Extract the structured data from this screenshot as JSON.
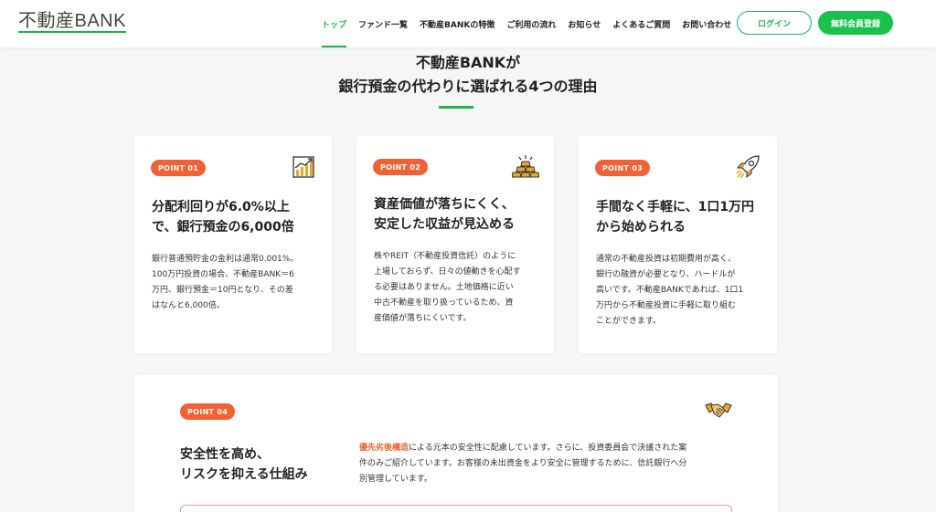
{
  "header": {
    "logo": "不動産BANK",
    "nav": [
      {
        "label": "トップ",
        "active": true
      },
      {
        "label": "ファンド一覧",
        "active": false
      },
      {
        "label": "不動産BANKの特徴",
        "active": false
      },
      {
        "label": "ご利用の流れ",
        "active": false
      },
      {
        "label": "お知らせ",
        "active": false
      },
      {
        "label": "よくあるご質問",
        "active": false
      },
      {
        "label": "お問い合わせ",
        "active": false
      }
    ],
    "login_label": "ログイン",
    "register_label": "無料会員登録"
  },
  "section": {
    "title_line1": "不動産BANKが",
    "title_line2": "銀行預金の代わりに選ばれる4つの理由"
  },
  "points": [
    {
      "badge": "POINT 01",
      "icon": "chart-growth-icon",
      "heading_line1": "分配利回りが6.0%以上",
      "heading_line2": "で、銀行預金の6,000倍",
      "body": [
        "銀行普通預貯金の金利は通常0.001%。",
        "100万円投資の場合、不動産BANK＝6",
        "万円、銀行預金＝10円となり、その差",
        "はなんと6,000倍。"
      ]
    },
    {
      "badge": "POINT 02",
      "icon": "gold-bars-icon",
      "heading_line1": "資産価値が落ちにくく、",
      "heading_line2": "安定した収益が見込める",
      "body": [
        "株やREIT（不動産投資信託）のように",
        "上場しておらず、日々の値動きを心配す",
        "る必要はありません。土地価格に近い",
        "中古不動産を取り扱っているため、資",
        "産価値が落ちにくいです。"
      ]
    },
    {
      "badge": "POINT 03",
      "icon": "rocket-icon",
      "heading_line1": "手間なく手軽に、1口1万円",
      "heading_line2": "から始められる",
      "body": [
        "通常の不動産投資は初期費用が高く、",
        "銀行の融資が必要となり、ハードルが",
        "高いです。不動産BANKであれば、1口1",
        "万円から不動産投資に手軽に取り組む",
        "ことができます。"
      ]
    },
    {
      "badge": "POINT 04",
      "icon": "handshake-icon",
      "heading_line1": "安全性を高め、",
      "heading_line2": "リスクを抑える仕組み",
      "body_accent": "優先劣後構造",
      "body_rest_line1": "による元本の安全性に配慮しています。さらに、投資委員会で決議された案",
      "body_line2": "件のみご紹介しています。お客様の未出資金をより安全に管理するために、信託銀行へ分",
      "body_line3": "別管理しています。"
    }
  ],
  "colors": {
    "brand_green": "#18b64a",
    "accent_orange": "#f26133",
    "gold": "#e8a825"
  }
}
